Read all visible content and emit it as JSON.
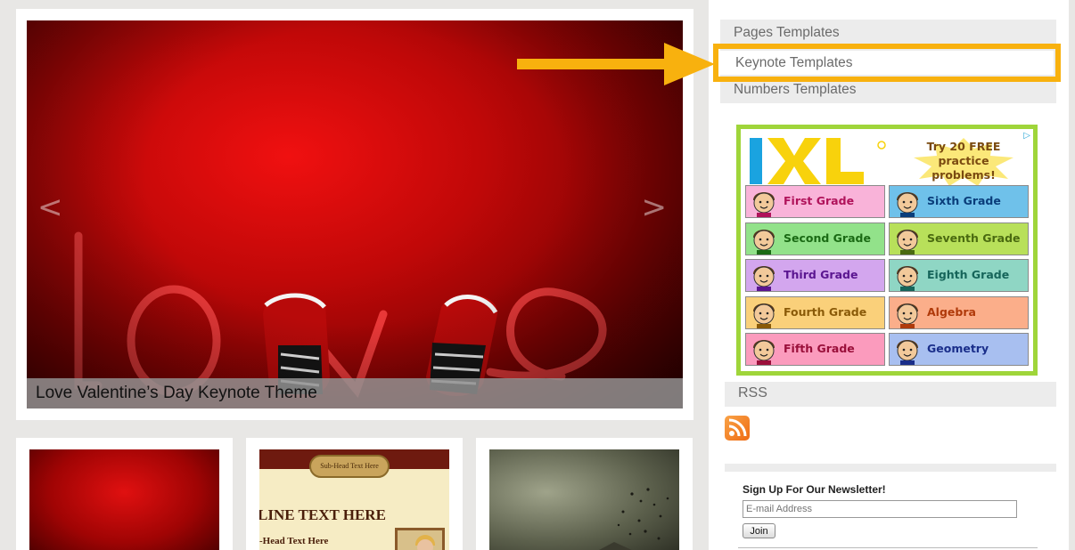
{
  "slider": {
    "caption": "Love Valentine’s Day Keynote Theme",
    "prev_arrow": "<",
    "next_arrow": ">"
  },
  "thumbnails": {
    "items": [
      {
        "name": "red-grunge"
      },
      {
        "name": "vintage-newsletter",
        "badge": "Sub-Head Text Here",
        "headline": "LINE TEXT HERE",
        "subhead": "-Head Text Here"
      },
      {
        "name": "dark-birds"
      }
    ]
  },
  "sidebar": {
    "nav": [
      {
        "label": "Pages Templates"
      },
      {
        "label": "Keynote Templates",
        "highlighted": true
      },
      {
        "label": "Numbers Templates"
      }
    ],
    "rss_label": "RSS",
    "newsletter": {
      "title": "Sign Up For Our Newsletter!",
      "email_placeholder": "E-mail Address",
      "join_label": "Join"
    }
  },
  "ad": {
    "choice_icon": "ad-choices-icon",
    "promo": "Try 20 FREE practice problems!",
    "grades": [
      {
        "label": "First Grade",
        "bg": "#f9b3d9",
        "color": "#b0125a"
      },
      {
        "label": "Sixth Grade",
        "bg": "#6fc1ea",
        "color": "#0a3d7a"
      },
      {
        "label": "Second Grade",
        "bg": "#92e28a",
        "color": "#1a6a14"
      },
      {
        "label": "Seventh Grade",
        "bg": "#b8e05a",
        "color": "#4a6a10"
      },
      {
        "label": "Third Grade",
        "bg": "#d3a6ee",
        "color": "#5a1590"
      },
      {
        "label": "Eighth Grade",
        "bg": "#8fd6c4",
        "color": "#16655a"
      },
      {
        "label": "Fourth Grade",
        "bg": "#fad07a",
        "color": "#8a5a08"
      },
      {
        "label": "Algebra",
        "bg": "#fbae8a",
        "color": "#b03a0a"
      },
      {
        "label": "Fifth Grade",
        "bg": "#fb9bbd",
        "color": "#9a0f3a"
      },
      {
        "label": "Geometry",
        "bg": "#a8bff0",
        "color": "#1a2e8a"
      }
    ],
    "colors": {
      "border": "#9fd53a",
      "logo_blue": "#1aa3e0",
      "logo_yellow": "#f8d20c"
    }
  },
  "annotation": {
    "color": "#f8b10e"
  }
}
